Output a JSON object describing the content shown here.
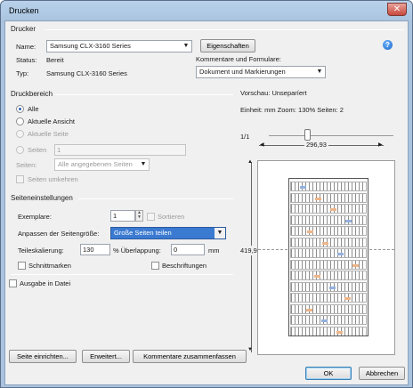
{
  "window": {
    "title": "Drucken",
    "close_symbol": "✕"
  },
  "printer": {
    "section_title": "Drucker",
    "name_label": "Name:",
    "name_value": "Samsung CLX-3160 Series",
    "properties_button": "Eigenschaften",
    "status_label": "Status:",
    "status_value": "Bereit",
    "type_label": "Typ:",
    "type_value": "Samsung CLX-3160 Series",
    "comments_label": "Kommentare und Formulare:",
    "comments_value": "Dokument und Markierungen",
    "help_icon": "question-mark"
  },
  "print_range": {
    "section_title": "Druckbereich",
    "options": [
      "Alle",
      "Aktuelle Ansicht",
      "Aktuelle Seite",
      "Seiten"
    ],
    "selected": "Alle",
    "pages_value": "1",
    "subset_label": "Seiten:",
    "subset_value": "Alle angegebenen Seiten",
    "reverse_label": "Seiten umkehren"
  },
  "page_settings": {
    "section_title": "Seiteneinstellungen",
    "copies_label": "Exemplare:",
    "copies_value": "1",
    "collate_label": "Sortieren",
    "scaling_label": "Anpassen der Seitengröße:",
    "scaling_value": "Große Seiten teilen",
    "tile_scale_label": "Teileskalierung:",
    "tile_scale_value": "130",
    "overlap_label": "% Überlappung:",
    "overlap_value": "0",
    "overlap_unit": "mm",
    "cut_marks_label": "Schnittmarken",
    "labels_label": "Beschriftungen"
  },
  "print_to_file_label": "Ausgabe in Datei",
  "preview": {
    "title": "Vorschau: Unseparíert",
    "info": "Einheit: mm Zoom: 130% Seiten: 2",
    "page_indicator": "1/1",
    "width_value": "296,93",
    "height_value": "419,95"
  },
  "buttons": {
    "page_setup": "Seite einrichten...",
    "advanced": "Erweitert...",
    "summarize_comments": "Kommentare zusammenfassen",
    "ok": "OK",
    "cancel": "Abbrechen"
  },
  "colors": {
    "accent": "#2a62b8",
    "selection": "#3b7ad1",
    "tag_orange": "#e07a2a"
  }
}
